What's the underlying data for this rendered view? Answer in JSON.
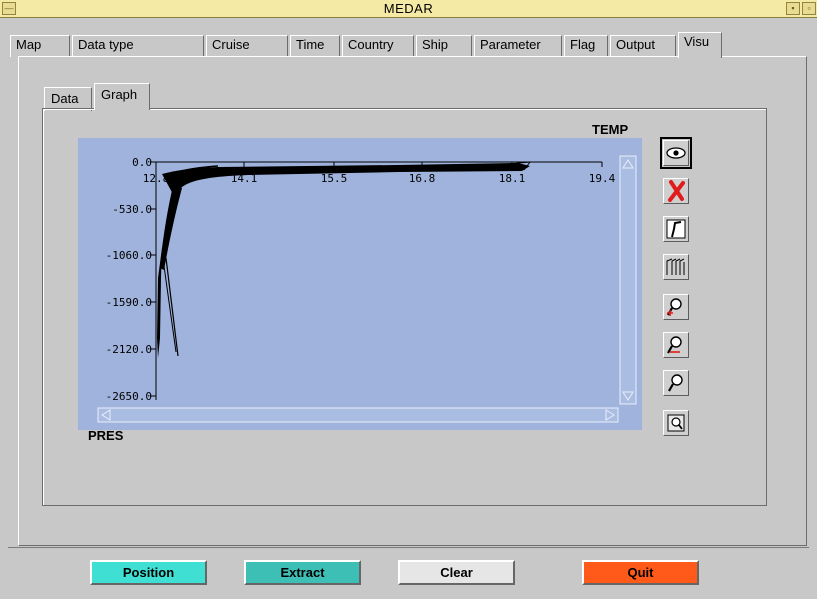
{
  "window": {
    "title": "MEDAR",
    "controls": {
      "menu": "—",
      "minimize": "▪",
      "maximize": "▫"
    }
  },
  "tabs": [
    {
      "label": "Map"
    },
    {
      "label": "Data type"
    },
    {
      "label": "Cruise"
    },
    {
      "label": "Time"
    },
    {
      "label": "Country"
    },
    {
      "label": "Ship"
    },
    {
      "label": "Parameter"
    },
    {
      "label": "Flag"
    },
    {
      "label": "Output"
    },
    {
      "label": "Visu",
      "active": true
    }
  ],
  "subtabs": [
    {
      "label": "Data"
    },
    {
      "label": "Graph",
      "active": true
    }
  ],
  "plot": {
    "x_variable": "TEMP",
    "y_variable": "PRES",
    "x_ticks": [
      "12.8",
      "14.1",
      "15.5",
      "16.8",
      "18.1",
      "19.4"
    ],
    "y_ticks": [
      "0.0",
      "-530.0",
      "-1060.0",
      "-1590.0",
      "-2120.0",
      "-2650.0"
    ],
    "background": "#9fb3dc"
  },
  "tools": [
    {
      "icon": "eye-icon",
      "selected": true
    },
    {
      "icon": "delete-x-icon"
    },
    {
      "icon": "single-profile-icon"
    },
    {
      "icon": "multi-profile-icon"
    },
    {
      "icon": "zoom-in-icon"
    },
    {
      "icon": "zoom-out-icon"
    },
    {
      "icon": "zoom-icon"
    },
    {
      "icon": "zoom-fit-icon"
    }
  ],
  "buttons": [
    {
      "label": "Position",
      "color": "#3fe0d3"
    },
    {
      "label": "Extract",
      "color": "#3dbfb6"
    },
    {
      "label": "Clear",
      "color": "#e6e6e6"
    },
    {
      "label": "Quit",
      "color": "#ff5a1a"
    }
  ]
}
